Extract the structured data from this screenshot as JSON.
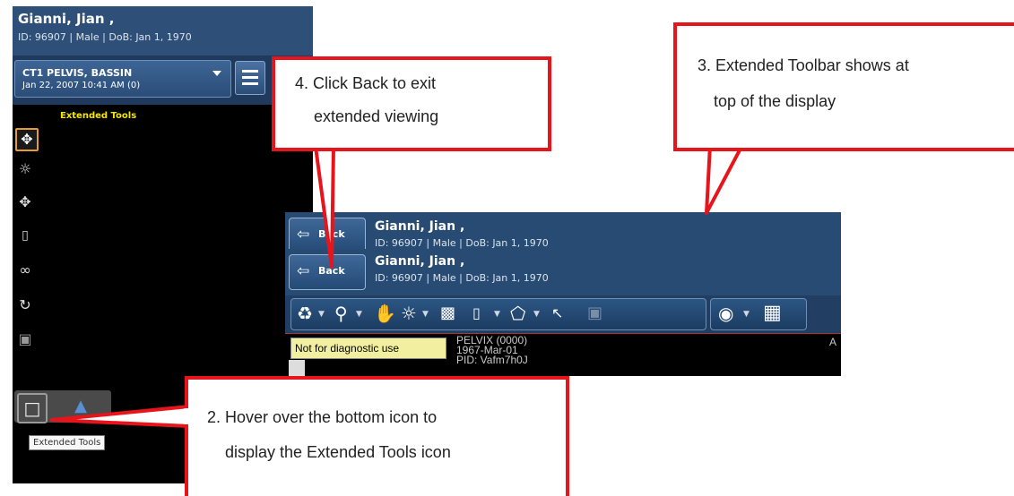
{
  "left_viewer": {
    "patient_name": "Gianni, Jian ,",
    "patient_info": "ID: 96907 | Male | DoB: Jan 1, 1970",
    "study_title": "CT1 PELVIS, BASSIN",
    "study_date": "Jan 22, 2007 10:41 AM (0)",
    "extended_tools_label": "Extended Tools",
    "tooltip": "Extended Tools",
    "tools": [
      "pan-icon",
      "brightness-icon",
      "zoom-icon",
      "ruler-icon",
      "link-icon",
      "rotate-icon",
      "volume-icon",
      "cube-icon"
    ]
  },
  "extended_toolbar": {
    "back_label": "Back",
    "patient_name": "Gianni, Jian ,",
    "patient_info": "ID: 96907 | Male | DoB: Jan 1, 1970",
    "diagnostic_note": "Not for diagnostic use",
    "image_info_1": "PELVIX (0000)",
    "image_info_2": "1967-Mar-01",
    "image_info_3": "PID: Vafm7h0J",
    "image_info_right": "A",
    "tools": [
      "stack-icon",
      "zoom-icon",
      "hand-icon",
      "brightness-icon",
      "window-icon",
      "ruler-icon",
      "polygon-icon",
      "hu-icon",
      "disabled-icon",
      "eye-icon",
      "hp-layout-icon"
    ]
  },
  "callouts": {
    "step2_line1": "2. Hover over the bottom icon to",
    "step2_line2": "display the Extended Tools icon",
    "step3_line1": "3. Extended Toolbar shows at",
    "step3_line2": "top of the display",
    "step4_line1": "4. Click Back to exit",
    "step4_line2": "extended viewing"
  },
  "colors": {
    "callout_border": "#e8141b",
    "header_blue": "#2e4f78",
    "extended_tools_label": "#f2e600",
    "active_tool_border": "#e59b2f"
  }
}
